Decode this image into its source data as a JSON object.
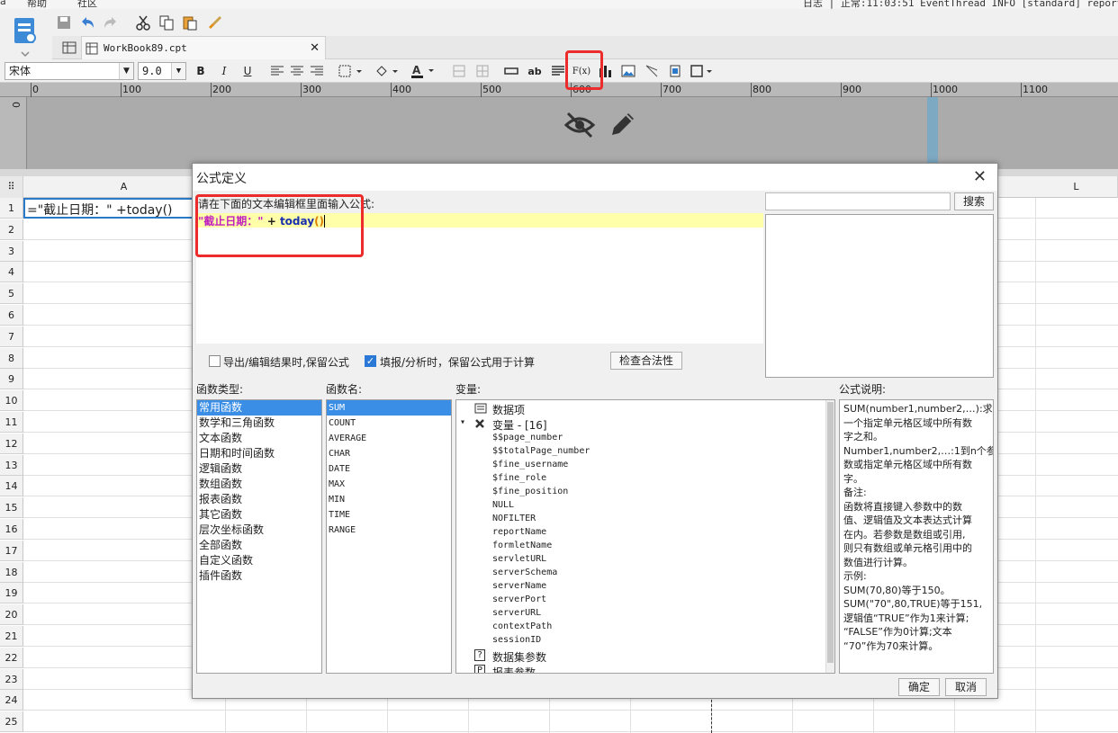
{
  "menubar": {
    "help": "帮助",
    "community": "社区",
    "status": "日志 | 正常:11:03:51 EventThread INFO [standard] reportle"
  },
  "tab": {
    "label": "WorkBook89.cpt"
  },
  "format": {
    "font": "宋体",
    "size": "9.0",
    "bold": "B",
    "italic": "I",
    "underline": "U",
    "ab_label": "ab",
    "fx_label": "F(x)"
  },
  "ruler": {
    "labels": [
      "0",
      "100",
      "200",
      "300",
      "400",
      "500",
      "600",
      "700",
      "800",
      "900",
      "1000",
      "1100"
    ],
    "v_label": "0"
  },
  "sheet": {
    "columns": [
      "A",
      "L"
    ],
    "rows": [
      "1",
      "2",
      "3",
      "4",
      "5",
      "6",
      "7",
      "8",
      "9",
      "10",
      "11",
      "12",
      "13",
      "14",
      "15",
      "16",
      "17",
      "18",
      "19",
      "20",
      "21",
      "22",
      "23",
      "24",
      "25"
    ],
    "cell_a1": "=\"截止日期：\" +today()"
  },
  "dialog": {
    "title": "公式定义",
    "prompt": "请在下面的文本编辑框里面输入公式:",
    "formula_str": "\"截止日期：\"",
    "formula_op": " +",
    "formula_fn": "today",
    "formula_parens": "()",
    "search_button": "搜索",
    "search_placeholder": "",
    "option1": "导出/编辑结果时,保留公式",
    "option1_checked": false,
    "option2": "填报/分析时，保留公式用于计算",
    "option2_checked": true,
    "check_button": "检查合法性",
    "category_header": "函数类型:",
    "fn_header": "函数名:",
    "var_header": "变量:",
    "desc_header": "公式说明:",
    "categories": [
      "常用函数",
      "数学和三角函数",
      "文本函数",
      "日期和时间函数",
      "逻辑函数",
      "数组函数",
      "报表函数",
      "其它函数",
      "层次坐标函数",
      "全部函数",
      "自定义函数",
      "插件函数"
    ],
    "functions": [
      "SUM",
      "COUNT",
      "AVERAGE",
      "CHAR",
      "DATE",
      "MAX",
      "MIN",
      "TIME",
      "RANGE"
    ],
    "var_data_item": "数据项",
    "var_group": "变量 - [16]",
    "variables": [
      "$$page_number",
      "$$totalPage_number",
      "$fine_username",
      "$fine_role",
      "$fine_position",
      "NULL",
      "NOFILTER",
      "reportName",
      "formletName",
      "servletURL",
      "serverSchema",
      "serverName",
      "serverPort",
      "serverURL",
      "contextPath",
      "sessionID"
    ],
    "var_dataset_params": "数据集参数",
    "var_report_params": "报表参数",
    "description": [
      "SUM(number1,number2,…):求",
      "一个指定单元格区域中所有数",
      "字之和。",
      "Number1,number2,…:1到n个参",
      "数或指定单元格区域中所有数",
      "字。",
      "备注:",
      "函数将直接键入参数中的数",
      "值、逻辑值及文本表达式计算",
      "在内。若参数是数组或引用,",
      "则只有数组或单元格引用中的",
      "数值进行计算。",
      "示例:",
      "SUM(70,80)等于150。",
      "SUM(\"70\",80,TRUE)等于151,",
      "逻辑值“TRUE”作为1来计算;",
      "“FALSE”作为0计算;文本",
      "“70”作为70来计算。"
    ],
    "ok_button": "确定",
    "cancel_button": "取消"
  },
  "colors": {
    "selection": "#3a8ee6",
    "highlight": "#ffffaa",
    "annotation": "#ee2b2b"
  }
}
